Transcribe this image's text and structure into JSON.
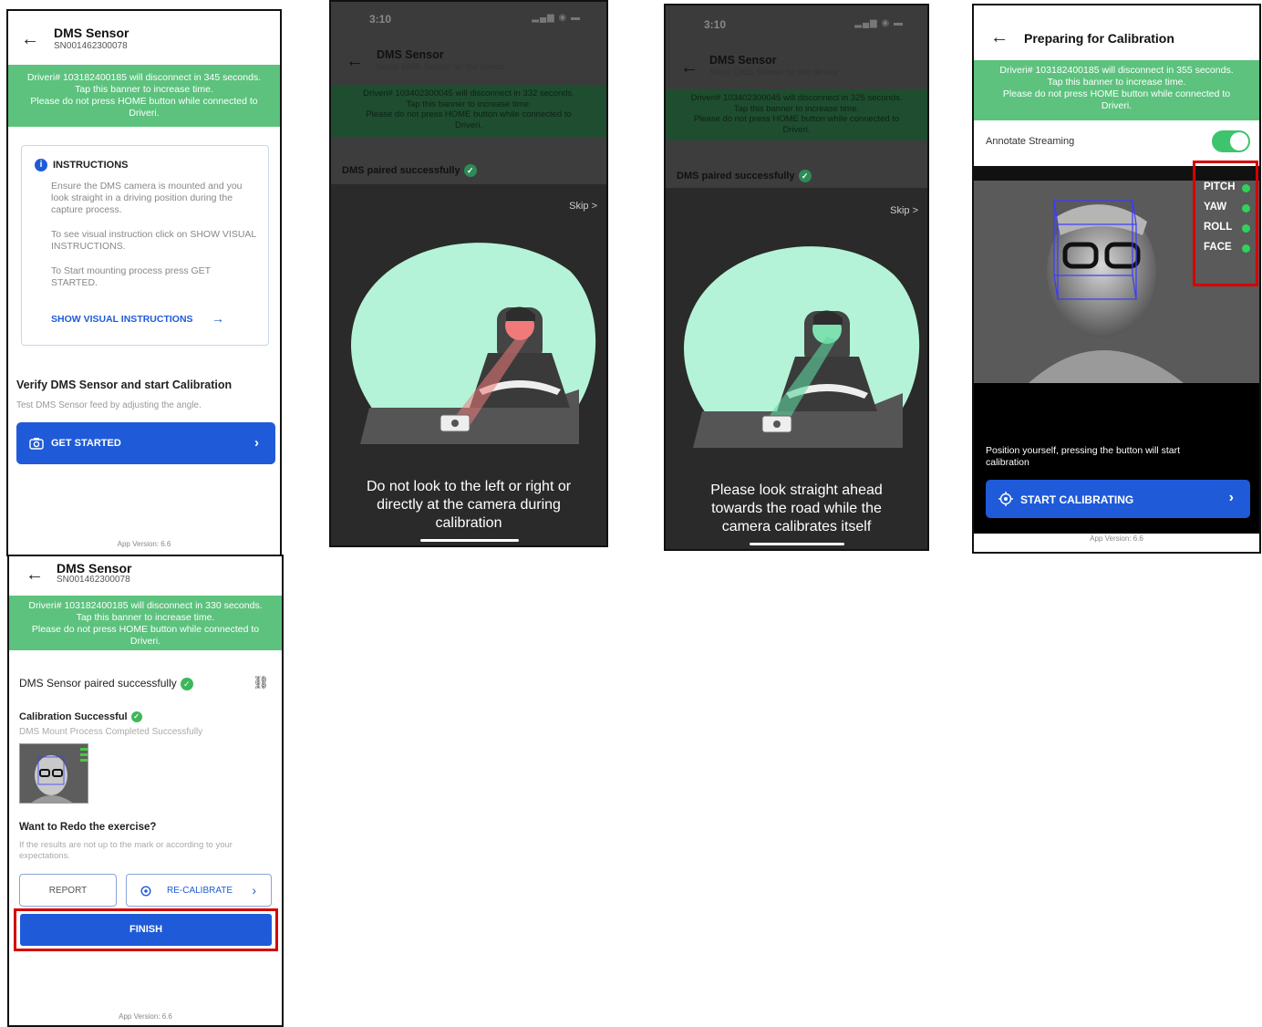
{
  "panel1": {
    "title": "DMS Sensor",
    "serial": "SN001462300078",
    "banner": [
      "Driveri# 103182400185 will disconnect in 345 seconds.",
      "Tap this banner to increase time.",
      "Please do not press HOME button while connected to",
      "Driveri."
    ],
    "instructions_title": "INSTRUCTIONS",
    "instr_p1": "Ensure the DMS camera is mounted and you look straight in a driving position during the capture process.",
    "instr_p2": "To see visual instruction click on SHOW VISUAL INSTRUCTIONS.",
    "instr_p3": "To Start mounting process press GET STARTED.",
    "show_visual": "SHOW VISUAL INSTRUCTIONS",
    "verify_title": "Verify DMS Sensor and start Calibration",
    "verify_sub": "Test DMS Sensor feed by adjusting the angle.",
    "get_started": "GET STARTED",
    "app_version": "App Version: 6.6"
  },
  "panel2": {
    "time": "3:10",
    "title": "DMS Sensor",
    "subtitle": "Setup DMS Sensor for the device",
    "banner": [
      "Driveri# 103402300045 will disconnect in 332 seconds.",
      "Tap this banner to increase time.",
      "Please do not press HOME button while connected to",
      "Driveri."
    ],
    "paired": "DMS paired successfully",
    "skip": "Skip >",
    "message": [
      "Do not look to the left or right or",
      "directly at the camera during",
      "calibration"
    ]
  },
  "panel3": {
    "time": "3:10",
    "title": "DMS Sensor",
    "subtitle": "Setup DMS Sensor for the device",
    "banner": [
      "Driveri# 103402300045 will disconnect in 325 seconds.",
      "Tap this banner to increase time.",
      "Please do not press HOME button while connected to",
      "Driveri."
    ],
    "paired": "DMS paired successfully",
    "skip": "Skip >",
    "message": [
      "Please look straight ahead",
      "towards the road while the",
      "camera calibrates itself"
    ]
  },
  "panel4": {
    "title": "Preparing for Calibration",
    "banner": [
      "Driveri# 103182400185 will disconnect in 355 seconds.",
      "Tap this banner to increase time.",
      "Please do not press HOME button while connected to",
      "Driveri."
    ],
    "annotate": "Annotate Streaming",
    "metrics": [
      "PITCH",
      "YAW",
      "ROLL",
      "FACE"
    ],
    "position_text": "Position yourself, pressing the button will start calibration",
    "start_btn": "START CALIBRATING",
    "app_version": "App Version: 6.6"
  },
  "panel5": {
    "title": "DMS Sensor",
    "serial": "SN001462300078",
    "banner": [
      "Driveri# 103182400185 will disconnect in 330 seconds.",
      "Tap this banner to increase time.",
      "Please do not press HOME button while connected to",
      "Driveri."
    ],
    "paired": "DMS Sensor paired successfully",
    "calib_title": "Calibration Successful",
    "calib_sub": "DMS Mount Process Completed Successfully",
    "redo_title": "Want to Redo the exercise?",
    "redo_sub": "If the results are not up to the mark or according to your expectations.",
    "report": "REPORT",
    "recalibrate": "RE-CALIBRATE",
    "finish": "FINISH",
    "app_version": "App Version: 6.6"
  },
  "colors": {
    "brand_blue": "#1f5bd8",
    "banner_green": "#5cc27d",
    "highlight_red": "#d40000"
  }
}
